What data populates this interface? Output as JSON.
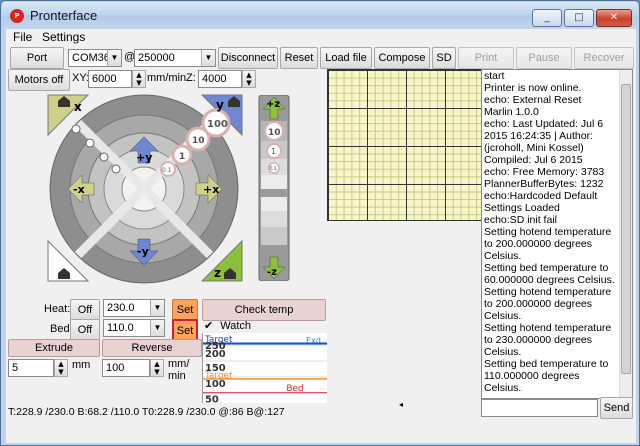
{
  "window": {
    "title": "Pronterface",
    "app_icon": "pronterface-icon",
    "controls": [
      "_",
      "□",
      "✕"
    ]
  },
  "menu": {
    "file": "File",
    "settings": "Settings"
  },
  "toolbar": {
    "port_label": "Port",
    "port_value": "COM36",
    "at": "@",
    "baud_value": "250000",
    "disconnect": "Disconnect",
    "reset": "Reset",
    "load_file": "Load file",
    "compose": "Compose",
    "sd": "SD",
    "print": "Print",
    "pause": "Pause",
    "recover": "Recover"
  },
  "motion": {
    "motors_off": "Motors off",
    "xy_label": "XY:",
    "xy_feed": "6000",
    "xy_unit": "mm/min",
    "z_label": "Z:",
    "z_feed": "4000"
  },
  "jog": {
    "x_home": "x",
    "y_home": "y",
    "z_home": "z",
    "plus_y": "+y",
    "minus_y": "-y",
    "plus_x": "+x",
    "minus_x": "-x",
    "plus_z": "+z",
    "minus_z": "-z",
    "steps": [
      "100",
      "10",
      "1",
      "0.1"
    ],
    "z_steps": [
      "10",
      "1",
      "0.1"
    ]
  },
  "temperature": {
    "heat_label": "Heat:",
    "heat_off": "Off",
    "heat_value": "230.0",
    "heat_set": "Set",
    "bed_label": "Bed:",
    "bed_off": "Off",
    "bed_value": "110.0",
    "bed_set": "Set",
    "check_temp": "Check temp",
    "watch_label": "Watch",
    "watch_checked": true
  },
  "extrude": {
    "extrude_label": "Extrude",
    "reverse_label": "Reverse",
    "length": "5",
    "length_unit": "mm",
    "speed": "100",
    "speed_unit_top": "mm/",
    "speed_unit_bottom": "min"
  },
  "graph": {
    "labels": [
      "Target",
      "Exd",
      "Target",
      "Bed"
    ],
    "ticks": [
      "250",
      "200",
      "150",
      "100",
      "50"
    ]
  },
  "log": {
    "lines": [
      "start",
      "Printer is now online.",
      "echo: External Reset",
      "Marlin 1.0.0",
      "echo: Last Updated: Jul  6",
      "2015 16:24:35 | Author:",
      "(jcroholl, Mini Kossel)",
      "Compiled: Jul  6 2015",
      "echo: Free Memory: 3783",
      "PlannerBufferBytes: 1232",
      "echo:Hardcoded Default",
      "Settings Loaded",
      "echo:SD init fail",
      "Setting hotend temperature",
      "to 200.000000 degrees",
      "Celsius.",
      "Setting bed temperature to",
      "60.000000 degrees Celsius.",
      "Setting hotend temperature",
      "to 200.000000 degrees",
      "Celsius.",
      "Setting hotend temperature",
      "to 230.000000 degrees",
      "Celsius.",
      "Setting bed temperature to",
      "110.000000 degrees Celsius."
    ],
    "command_placeholder": "",
    "send": "Send"
  },
  "status": {
    "text": "T:228.9 /230.0 B:68.2 /110.0 T0:228.9 /230.0 @:86 B@:127"
  },
  "colors": {
    "xy_green": "#8cbf3a",
    "xy_blue": "#6f87d3",
    "xy_olive": "#cfd18a",
    "orange": "#ffa35a",
    "grid_bg": "#f6f6c8"
  }
}
